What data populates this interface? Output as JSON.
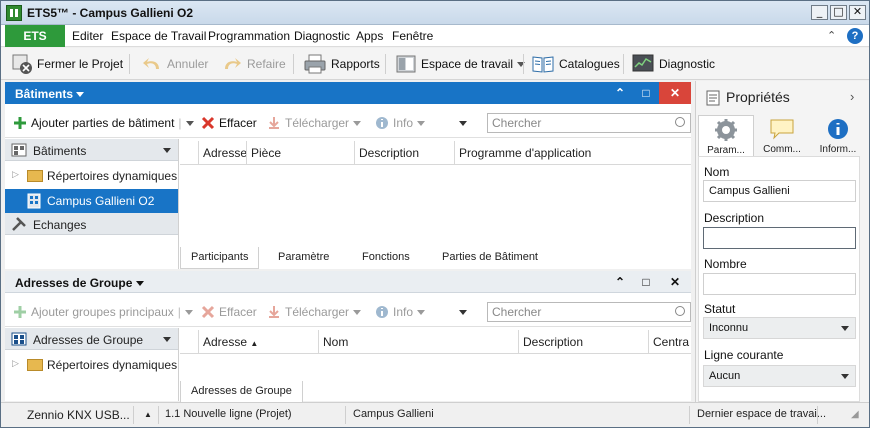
{
  "window": {
    "title": "ETS5™ - Campus Gallieni O2",
    "min": "_",
    "max": "□",
    "close": "✕"
  },
  "menu": {
    "ets_tab": "ETS",
    "items": [
      "Editer",
      "Espace de Travail",
      "Programmation",
      "Diagnostic",
      "Apps",
      "Fenêtre"
    ],
    "collapse": "⌃",
    "help": "?"
  },
  "toolbar": {
    "close_project": "Fermer le Projet",
    "undo": "Annuler",
    "redo": "Refaire",
    "reports": "Rapports",
    "workspace": "Espace de travail",
    "catalogs": "Catalogues",
    "diagnostics": "Diagnostic"
  },
  "buildings_panel": {
    "title": "Bâtiments",
    "add": "Ajouter parties de bâtiment",
    "delete": "Effacer",
    "download": "Télécharger",
    "info": "Info",
    "search_placeholder": "Chercher",
    "tree_header": "Bâtiments",
    "tree_items": [
      "Répertoires dynamiques",
      "Campus Gallieni O2"
    ],
    "exchanges": "Echanges",
    "columns": [
      "Adresse",
      "Pièce",
      "Description",
      "Programme d'application"
    ],
    "tabs": [
      "Participants",
      "Paramètre",
      "Fonctions",
      "Parties de Bâtiment"
    ]
  },
  "groups_panel": {
    "title": "Adresses de Groupe",
    "add": "Ajouter groupes principaux",
    "delete": "Effacer",
    "download": "Télécharger",
    "info": "Info",
    "search_placeholder": "Chercher",
    "tree_header": "Adresses de Groupe",
    "tree_items": [
      "Répertoires dynamiques"
    ],
    "columns": [
      "Adresse",
      "Nom",
      "Description",
      "Centra"
    ],
    "tabs": [
      "Adresses de Groupe"
    ]
  },
  "properties": {
    "title": "Propriétés",
    "tabs": [
      "Param...",
      "Comm...",
      "Inform..."
    ],
    "name_label": "Nom",
    "name_value": "Campus Gallieni",
    "description_label": "Description",
    "description_value": "",
    "number_label": "Nombre",
    "number_value": "",
    "status_label": "Statut",
    "status_value": "Inconnu",
    "current_line_label": "Ligne courante",
    "current_line_value": "Aucun"
  },
  "statusbar": {
    "interface": "Zennio KNX USB...",
    "line": "1.1 Nouvelle ligne (Projet)",
    "building": "Campus Gallieni",
    "workspace": "Dernier espace de travai..."
  }
}
